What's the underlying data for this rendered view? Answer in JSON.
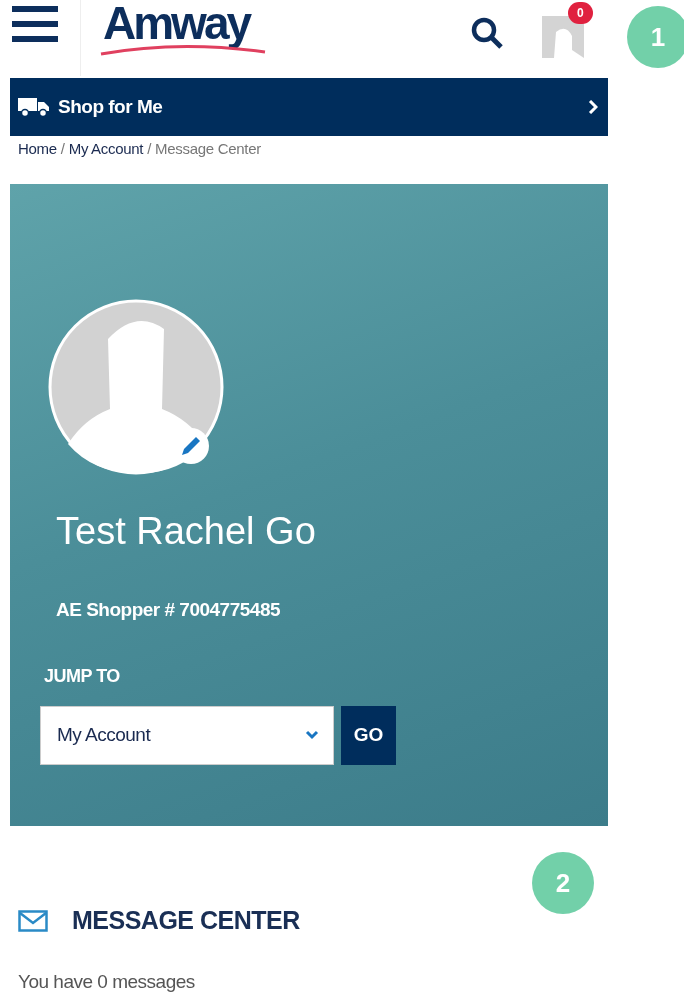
{
  "header": {
    "logo": "Amway",
    "cart_count": "0"
  },
  "shop_bar": {
    "label": "Shop for **Me**"
  },
  "breadcrumb": [
    {
      "label": "Home",
      "link": true
    },
    {
      "separator": "/",
      "label": "My Account",
      "link": true
    },
    {
      "separator": "/",
      "label": "Message Center",
      "link": false
    }
  ],
  "profile": {
    "name": "Test Rachel Go",
    "shopper_id": "AE Shopper # 7004775485",
    "jump_label": "JUMP TO",
    "jump_value": "My Account",
    "go_button": "GO"
  },
  "message_center": {
    "title": "MESSAGE CENTER",
    "text": "You have 0 messages"
  },
  "annotations": [
    {
      "label": "1"
    },
    {
      "label": "2"
    }
  ]
}
